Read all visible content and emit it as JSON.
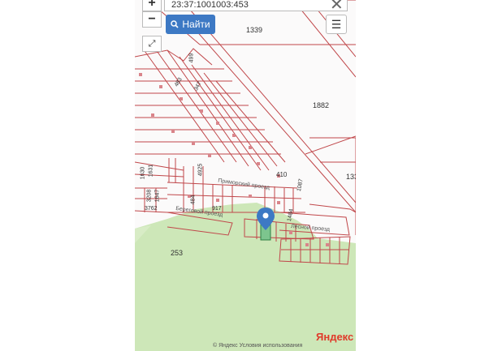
{
  "search": {
    "value": "23:37:1001003:453"
  },
  "buttons": {
    "find_label": "Найти",
    "zoom_in": "+",
    "zoom_out": "−"
  },
  "parcels": {
    "p1339": "1339",
    "p1882": "1882",
    "p133": "133",
    "p253": "253",
    "p410": "410",
    "p1087": "1087",
    "p1484": "1484",
    "p917": "917",
    "p3762": "3762",
    "p1630": "1630",
    "p1631": "1631",
    "p1647": "1647",
    "p3208": "3208",
    "p4925": "4925",
    "p484": "484",
    "p499": "499",
    "p483": "483",
    "p347": "347"
  },
  "streets": {
    "primorsky": "Приморский проезд",
    "beregovoy": "Береговой проезд",
    "lesnoy": "Лесной проезд"
  },
  "footer": {
    "brand": "Яндекс",
    "terms": "© Яндекс  Условия использования"
  },
  "colors": {
    "parcel_line": "#c0474a",
    "forest": "#cde7b8",
    "button_blue": "#3d79c4",
    "marker": "#3d79c4"
  },
  "icons": [
    "search-icon",
    "close-icon",
    "menu-icon",
    "fullscreen-icon",
    "map-marker-icon"
  ]
}
